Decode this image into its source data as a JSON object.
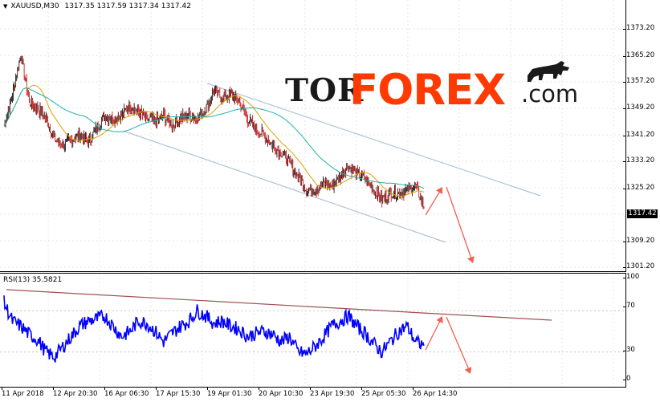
{
  "main_header": {
    "symbol": "XAUUSD,M30",
    "ohlc": "1317.35 1317.59 1317.34 1317.42"
  },
  "rsi_header": {
    "label": "RSI(13) 35.5821"
  },
  "current_price": "1317.42",
  "logo": {
    "tor": "TOR",
    "forex": "FOREX",
    "com": ".com"
  },
  "price_axis": [
    "1373.20",
    "1365.20",
    "1357.20",
    "1349.20",
    "1341.20",
    "1333.20",
    "1325.20",
    "1309.20",
    "1301.20"
  ],
  "rsi_axis": [
    "100",
    "70",
    "30",
    "0"
  ],
  "time_axis": [
    "11 Apr 2018",
    "12 Apr 20:30",
    "16 Apr 06:30",
    "17 Apr 15:30",
    "19 Apr 01:30",
    "20 Apr 10:30",
    "23 Apr 19:30",
    "25 Apr 05:30",
    "26 Apr 14:30"
  ],
  "colors": {
    "bull_candle": "#000000",
    "bear_candle": "#cc0000",
    "ma_fast": "#e0a000",
    "ma_slow": "#20b2aa",
    "channel": "#b0c4d8",
    "rsi_line": "#0000ff",
    "rsi_trend": "#a05050",
    "forecast_arrow": "#f06050"
  },
  "chart_data": {
    "type": "line",
    "series": [
      {
        "values": [
          1342,
          1351,
          1363,
          1349,
          1347,
          1344,
          1338,
          1336,
          1338,
          1339,
          1337,
          1341,
          1345,
          1344,
          1345,
          1348,
          1346,
          1344,
          1343,
          1345,
          1342,
          1344,
          1345,
          1344,
          1347,
          1352,
          1350,
          1351,
          1349,
          1344,
          1341,
          1339,
          1336,
          1334,
          1331,
          1327,
          1323,
          1323,
          1325,
          1324,
          1327,
          1330,
          1328,
          1326,
          1323,
          1320,
          1322,
          1322,
          1323,
          1324,
          1318
        ]
      }
    ],
    "rsi": {
      "values": [
        78,
        60,
        55,
        47,
        42,
        30,
        25,
        35,
        45,
        55,
        60,
        62,
        65,
        55,
        45,
        50,
        60,
        58,
        50,
        40,
        48,
        55,
        60,
        70,
        65,
        58,
        60,
        55,
        52,
        45,
        48,
        50,
        47,
        40,
        45,
        30,
        28,
        35,
        44,
        55,
        60,
        65,
        55,
        48,
        38,
        30,
        40,
        50,
        55,
        40,
        36
      ]
    },
    "ylim": [
      1299,
      1379
    ]
  }
}
